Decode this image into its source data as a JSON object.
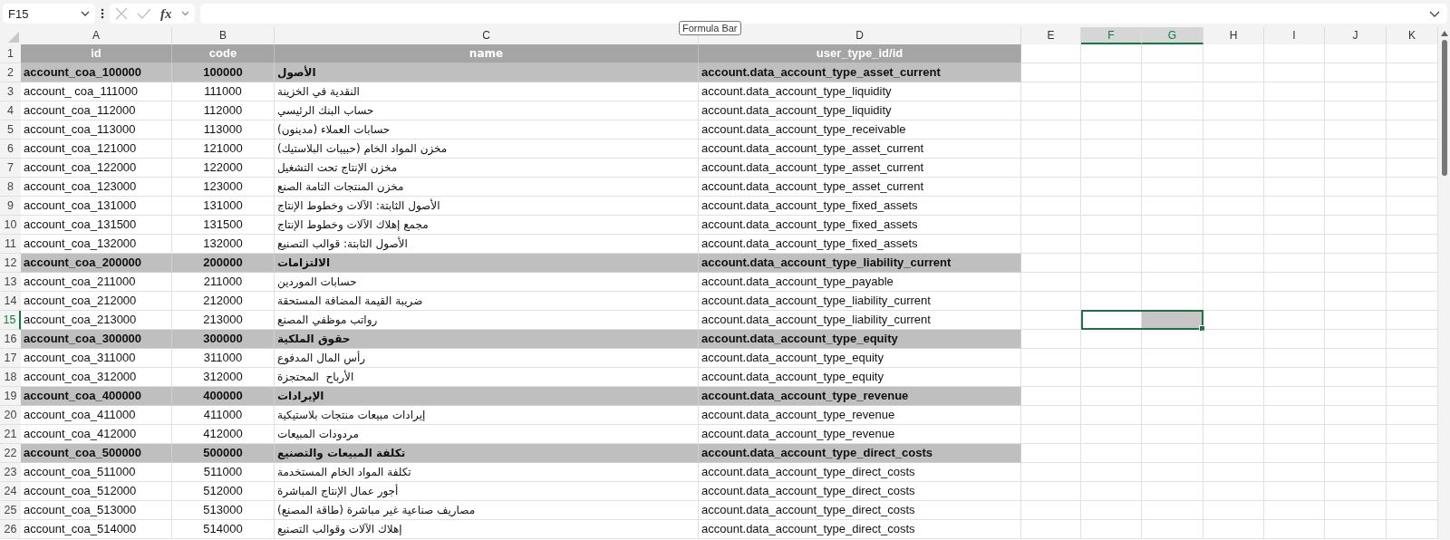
{
  "formula_bar": {
    "name_box": "F15",
    "function_button": "fx",
    "tooltip": "Formula Bar"
  },
  "columns": [
    {
      "letter": "A",
      "selected": false
    },
    {
      "letter": "B",
      "selected": false
    },
    {
      "letter": "C",
      "selected": false
    },
    {
      "letter": "D",
      "selected": false
    },
    {
      "letter": "E",
      "selected": false
    },
    {
      "letter": "F",
      "selected": true
    },
    {
      "letter": "G",
      "selected": true
    },
    {
      "letter": "H",
      "selected": false
    },
    {
      "letter": "I",
      "selected": false
    },
    {
      "letter": "J",
      "selected": false
    },
    {
      "letter": "K",
      "selected": false
    }
  ],
  "rows": [
    {
      "number": "1",
      "kind": "header",
      "selected": false,
      "cells": [
        "id",
        "code",
        "name",
        "user_type_id/id"
      ]
    },
    {
      "number": "2",
      "kind": "category",
      "selected": false,
      "cells": [
        "account_coa_100000",
        "100000",
        "الأصول",
        "account.data_account_type_asset_current"
      ]
    },
    {
      "number": "3",
      "kind": "account",
      "selected": false,
      "cells": [
        "account_ coa_111000",
        "111000",
        "النقدية في الخزينة",
        "account.data_account_type_liquidity"
      ]
    },
    {
      "number": "4",
      "kind": "account",
      "selected": false,
      "cells": [
        "account_coa_112000",
        "112000",
        "حساب البنك الرئيسي",
        "account.data_account_type_liquidity"
      ]
    },
    {
      "number": "5",
      "kind": "account",
      "selected": false,
      "cells": [
        "account_coa_113000",
        "113000",
        "حسابات العملاء (مدينون)",
        "account.data_account_type_receivable"
      ]
    },
    {
      "number": "6",
      "kind": "account",
      "selected": false,
      "cells": [
        "account_coa_121000",
        "121000",
        "مخزن المواد الخام (حبيبات البلاستيك)",
        "account.data_account_type_asset_current"
      ]
    },
    {
      "number": "7",
      "kind": "account",
      "selected": false,
      "cells": [
        "account_coa_122000",
        "122000",
        "مخزن الإنتاج تحت التشغيل",
        "account.data_account_type_asset_current"
      ]
    },
    {
      "number": "8",
      "kind": "account",
      "selected": false,
      "cells": [
        "account_coa_123000",
        "123000",
        "مخزن المنتجات التامة الصنع",
        "account.data_account_type_asset_current"
      ]
    },
    {
      "number": "9",
      "kind": "account",
      "selected": false,
      "cells": [
        "account_coa_131000",
        "131000",
        "الأصول الثابتة: الآلات وخطوط الإنتاج",
        "account.data_account_type_fixed_assets"
      ]
    },
    {
      "number": "10",
      "kind": "account",
      "selected": false,
      "cells": [
        "account_coa_131500",
        "131500",
        "مجمع إهلاك الآلات وخطوط الإنتاج",
        "account.data_account_type_fixed_assets"
      ]
    },
    {
      "number": "11",
      "kind": "account",
      "selected": false,
      "cells": [
        "account_coa_132000",
        "132000",
        "الأصول الثابتة: قوالب التصنيع",
        "account.data_account_type_fixed_assets"
      ]
    },
    {
      "number": "12",
      "kind": "category",
      "selected": false,
      "cells": [
        "account_coa_200000",
        "200000",
        "الالتزامات",
        "account.data_account_type_liability_current"
      ]
    },
    {
      "number": "13",
      "kind": "account",
      "selected": false,
      "cells": [
        "account_coa_211000",
        "211000",
        "حسابات الموردين",
        "account.data_account_type_payable"
      ]
    },
    {
      "number": "14",
      "kind": "account",
      "selected": false,
      "cells": [
        "account_coa_212000",
        "212000",
        "ضريبة القيمة المضافة المستحقة",
        "account.data_account_type_liability_current"
      ]
    },
    {
      "number": "15",
      "kind": "account",
      "selected": true,
      "cells": [
        "account_coa_213000",
        "213000",
        "رواتب موظفي المصنع",
        "account.data_account_type_liability_current"
      ]
    },
    {
      "number": "16",
      "kind": "category",
      "selected": false,
      "cells": [
        "account_coa_300000",
        "300000",
        "حقوق الملكية",
        "account.data_account_type_equity"
      ]
    },
    {
      "number": "17",
      "kind": "account",
      "selected": false,
      "cells": [
        "account_coa_311000",
        "311000",
        "رأس المال المدفوع",
        "account.data_account_type_equity"
      ]
    },
    {
      "number": "18",
      "kind": "account",
      "selected": false,
      "cells": [
        "account_coa_312000",
        "312000",
        "الأرباح  المحتجزة",
        "account.data_account_type_equity"
      ]
    },
    {
      "number": "19",
      "kind": "category",
      "selected": false,
      "cells": [
        "account_coa_400000",
        "400000",
        "الإيرادات",
        "account.data_account_type_revenue"
      ]
    },
    {
      "number": "20",
      "kind": "account",
      "selected": false,
      "cells": [
        "account_coa_411000",
        "411000",
        "إيرادات مبيعات منتجات بلاستيكية",
        "account.data_account_type_revenue"
      ]
    },
    {
      "number": "21",
      "kind": "account",
      "selected": false,
      "cells": [
        "account_coa_412000",
        "412000",
        "مردودات المبيعات",
        "account.data_account_type_revenue"
      ]
    },
    {
      "number": "22",
      "kind": "category",
      "selected": false,
      "cells": [
        "account_coa_500000",
        "500000",
        "تكلفة المبيعات والتصنيع",
        "account.data_account_type_direct_costs"
      ]
    },
    {
      "number": "23",
      "kind": "account",
      "selected": false,
      "cells": [
        "account_coa_511000",
        "511000",
        "تكلفة المواد الخام المستخدمة",
        "account.data_account_type_direct_costs"
      ]
    },
    {
      "number": "24",
      "kind": "account",
      "selected": false,
      "cells": [
        "account_coa_512000",
        "512000",
        "أجور عمال الإنتاج المباشرة",
        "account.data_account_type_direct_costs"
      ]
    },
    {
      "number": "25",
      "kind": "account",
      "selected": false,
      "cells": [
        "account_coa_513000",
        "513000",
        "مصاريف صناعية غير مباشرة (طاقة المصنع)",
        "account.data_account_type_direct_costs"
      ]
    },
    {
      "number": "26",
      "kind": "account",
      "selected": false,
      "cells": [
        "account_coa_514000",
        "514000",
        "إهلاك الآلات وقوالب التصنيع",
        "account.data_account_type_direct_costs"
      ]
    }
  ]
}
